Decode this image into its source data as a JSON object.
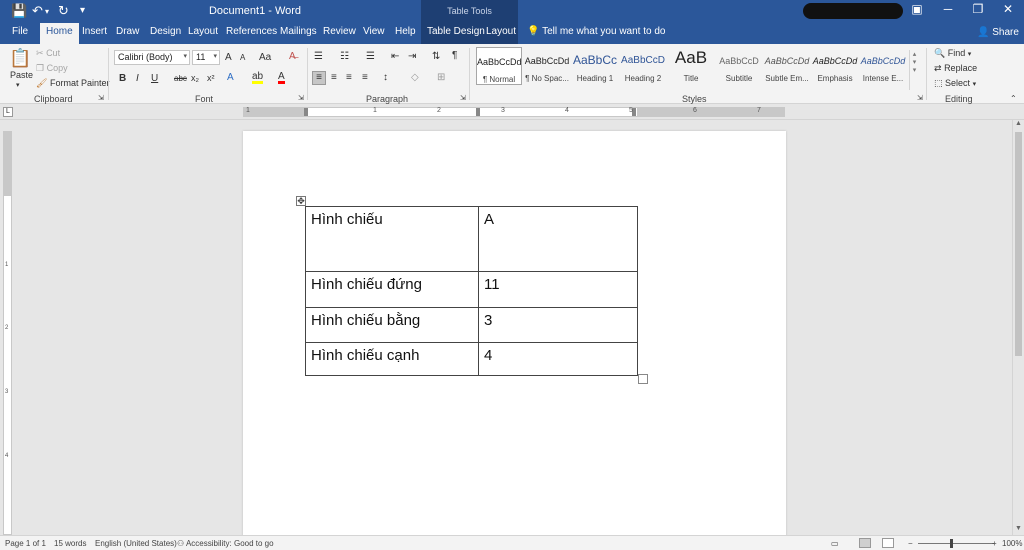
{
  "titlebar": {
    "document_title": "Document1 - Word",
    "context_label": "Table Tools",
    "qa_save_icon": "save-icon",
    "qa_undo_icon": "undo-icon",
    "qa_redo_icon": "redo-icon"
  },
  "tabs": {
    "file": "File",
    "home": "Home",
    "insert": "Insert",
    "draw": "Draw",
    "design": "Design",
    "layout": "Layout",
    "references": "References",
    "mailings": "Mailings",
    "review": "Review",
    "view": "View",
    "help": "Help",
    "table_design": "Table Design",
    "table_layout": "Layout",
    "tell_me": "Tell me what you want to do",
    "share": "Share"
  },
  "ribbon": {
    "clipboard": {
      "label": "Clipboard",
      "paste": "Paste",
      "cut": "Cut",
      "copy": "Copy",
      "format_painter": "Format Painter"
    },
    "font": {
      "label": "Font",
      "font_name": "Calibri (Body)",
      "font_size": "11",
      "bold": "B",
      "italic": "I",
      "underline": "U",
      "strike": "abc",
      "subscript": "x₂",
      "superscript": "x²",
      "grow": "A",
      "shrink": "A",
      "case": "Aa"
    },
    "paragraph": {
      "label": "Paragraph",
      "show_marks": "¶"
    },
    "styles": {
      "label": "Styles",
      "items": [
        {
          "preview": "AaBbCcDd",
          "name": "¶ Normal"
        },
        {
          "preview": "AaBbCcDd",
          "name": "¶ No Spac..."
        },
        {
          "preview": "AaBbCc",
          "name": "Heading 1"
        },
        {
          "preview": "AaBbCcD",
          "name": "Heading 2"
        },
        {
          "preview": "AaB",
          "name": "Title"
        },
        {
          "preview": "AaBbCcD",
          "name": "Subtitle"
        },
        {
          "preview": "AaBbCcDd",
          "name": "Subtle Em..."
        },
        {
          "preview": "AaBbCcDd",
          "name": "Emphasis"
        },
        {
          "preview": "AaBbCcDd",
          "name": "Intense E..."
        }
      ]
    },
    "editing": {
      "label": "Editing",
      "find": "Find",
      "replace": "Replace",
      "select": "Select"
    }
  },
  "ruler": {
    "numbers": [
      "1",
      "1",
      "2",
      "3",
      "4",
      "5",
      "6",
      "7"
    ]
  },
  "document": {
    "table": [
      [
        "Hình chiếu",
        "A"
      ],
      [
        "Hình chiếu đứng",
        "11"
      ],
      [
        "Hình chiếu bằng",
        "3"
      ],
      [
        "Hình chiếu cạnh",
        "4"
      ]
    ]
  },
  "statusbar": {
    "page": "Page 1 of 1",
    "words": "15 words",
    "language": "English (United States)",
    "accessibility": "Accessibility: Good to go",
    "zoom": "100%"
  },
  "colors": {
    "word_blue": "#2b579a",
    "context_tab": "#1e3f73",
    "ribbon_bg": "#f3f3f3",
    "canvas_bg": "#e6e6e6"
  }
}
